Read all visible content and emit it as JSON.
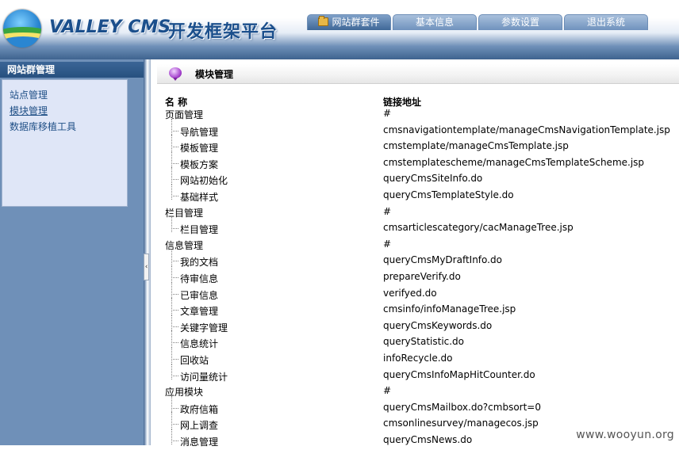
{
  "header": {
    "brand_en": "VALLEY CMS",
    "brand_cn": "开发框架平台",
    "tabs": [
      {
        "label": "网站群套件",
        "active": true,
        "icon": "folder-icon"
      },
      {
        "label": "基本信息",
        "active": false
      },
      {
        "label": "参数设置",
        "active": false
      },
      {
        "label": "退出系统",
        "active": false
      }
    ]
  },
  "sidebar": {
    "title": "网站群管理",
    "items": [
      {
        "label": "站点管理"
      },
      {
        "label": "模块管理"
      },
      {
        "label": "数据库移植工具"
      }
    ],
    "collapse_glyph": "‹"
  },
  "main": {
    "title": "模块管理",
    "title_icon": "speech-bubble-icon",
    "columns": {
      "name": "名 称",
      "link": "链接地址"
    },
    "rows": [
      {
        "name": "页面管理",
        "link": "#",
        "level": 0
      },
      {
        "name": "导航管理",
        "link": "cmsnavigationtemplate/manageCmsNavigationTemplate.jsp",
        "level": 1
      },
      {
        "name": "模板管理",
        "link": "cmstemplate/manageCmsTemplate.jsp",
        "level": 1
      },
      {
        "name": "模板方案",
        "link": "cmstemplatescheme/manageCmsTemplateScheme.jsp",
        "level": 1
      },
      {
        "name": "网站初始化",
        "link": "queryCmsSiteInfo.do",
        "level": 1
      },
      {
        "name": "基础样式",
        "link": "queryCmsTemplateStyle.do",
        "level": 1
      },
      {
        "name": "栏目管理",
        "link": "#",
        "level": 0
      },
      {
        "name": "栏目管理",
        "link": "cmsarticlescategory/cacManageTree.jsp",
        "level": 1
      },
      {
        "name": "信息管理",
        "link": "#",
        "level": 0
      },
      {
        "name": "我的文档",
        "link": "queryCmsMyDraftInfo.do",
        "level": 1
      },
      {
        "name": "待审信息",
        "link": "prepareVerify.do",
        "level": 1
      },
      {
        "name": "已审信息",
        "link": "verifyed.do",
        "level": 1
      },
      {
        "name": "文章管理",
        "link": "cmsinfo/infoManageTree.jsp",
        "level": 1
      },
      {
        "name": "关键字管理",
        "link": "queryCmsKeywords.do",
        "level": 1
      },
      {
        "name": "信息统计",
        "link": "queryStatistic.do",
        "level": 1
      },
      {
        "name": "回收站",
        "link": "infoRecycle.do",
        "level": 1
      },
      {
        "name": "访问量统计",
        "link": "queryCmsInfoMapHitCounter.do",
        "level": 1
      },
      {
        "name": "应用模块",
        "link": "#",
        "level": 0
      },
      {
        "name": "政府信箱",
        "link": "queryCmsMailbox.do?cmbsort=0",
        "level": 1
      },
      {
        "name": "网上调查",
        "link": "cmsonlinesurvey/managecos.jsp",
        "level": 1
      },
      {
        "name": "消息管理",
        "link": "queryCmsNews.do",
        "level": 1
      }
    ]
  },
  "watermark": "www.wooyun.org",
  "colors": {
    "header_dark": "#3e638f",
    "sidebar_bg": "#6f90b8",
    "sidebar_panel": "#dfe6f7",
    "link_blue": "#1f4f86",
    "brand_blue": "#1b4f8c"
  }
}
